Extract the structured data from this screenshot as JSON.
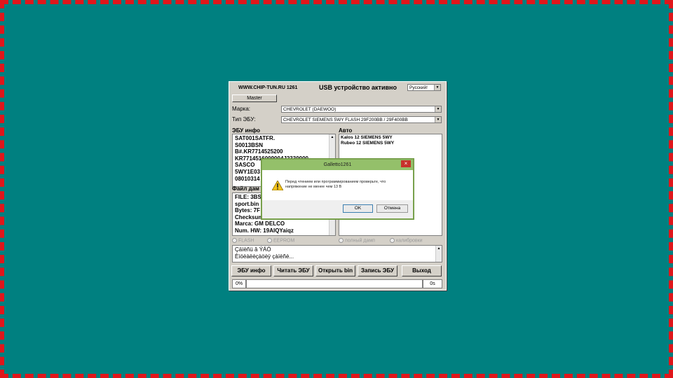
{
  "app": {
    "site": "WWW.CHIP-TUN.RU 1261",
    "usb_status": "USB устройство активно",
    "language": "Русский!",
    "master_label": "Master",
    "make_label": "Марка:",
    "make_value": "CHEVROLET (DAEWOO)",
    "ecu_type_label": "Тип ЭБУ:",
    "ecu_type_value": "CHEVROLET SIEMENS 5WY FLASH 29F200BB / 29F400BB",
    "ecu_info_label": "ЭБУ инфо",
    "ecu_info_lines": [
      "SAT001SATFR.",
      "S0013BSN",
      "B#.KR7714525200",
      "KR7714516009004J2330000",
      "SASCO",
      "5WY1E03",
      "08010314"
    ],
    "auto_label": "Авто",
    "auto_lines": [
      "Kalos 12 SIEMENS 5WY",
      "Rubeo 12 SIEMENS 5WY"
    ],
    "file_label": "Файл дам",
    "file_lines": [
      "FILE: 3BS",
      "sport.bin",
      "Bytes: 7F",
      "Checksum",
      "Marca: GM DELCO",
      "Num. HW: 19AIQYaiqz"
    ],
    "radio_flash": "FLASH",
    "radio_eeprom": "EEPROM",
    "radio_full": "полный дамп",
    "radio_calib": "калибровки",
    "log_lines": [
      "Çäïèñü â ÝÁÓ",
      "Èìöèàëèçàöèÿ çàïèñè..."
    ],
    "buttons": {
      "ecu_info": "ЭБУ инфо",
      "read": "Читать ЭБУ",
      "open": "Открыть bin",
      "write": "Запись ЭБУ",
      "exit": "Выход"
    },
    "progress_percent": "0%",
    "progress_value": 0,
    "elapsed": "0s"
  },
  "dialog": {
    "title": "Galletto1261",
    "close": "×",
    "message": "Перед чтением или программированием проверьте, что напряжение не менее чем 13 В",
    "ok": "OK",
    "cancel": "Отмена",
    "warning_icon": "warning-icon"
  }
}
